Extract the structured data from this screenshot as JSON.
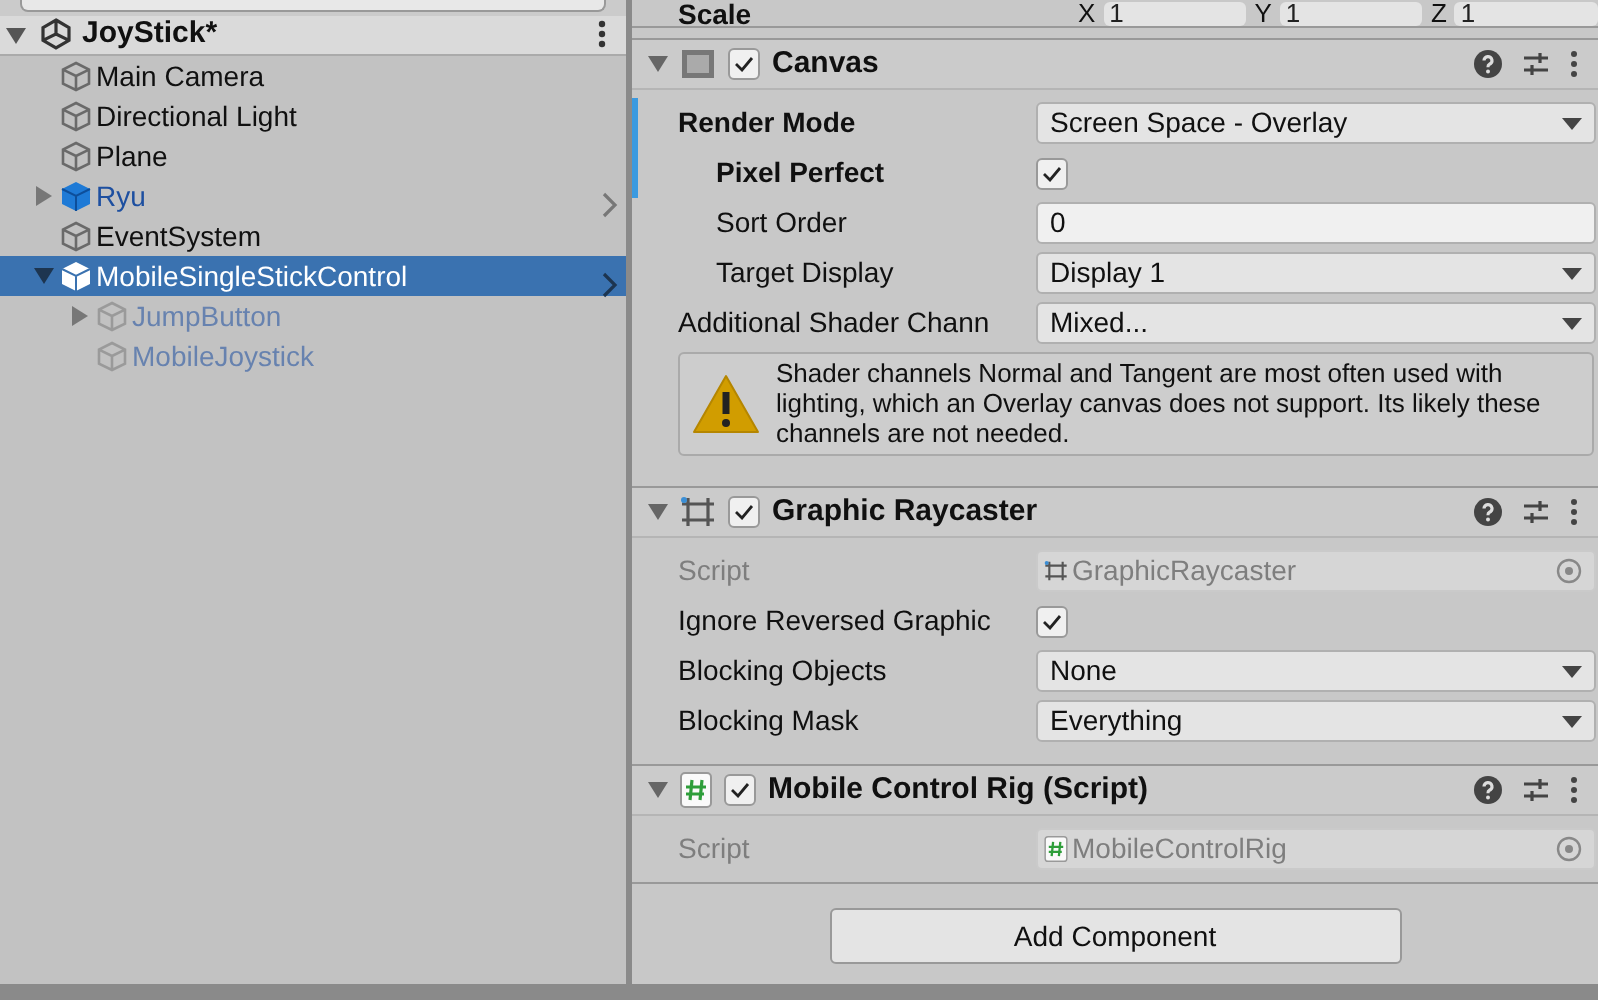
{
  "hierarchy": {
    "scene": {
      "name": "JoyStick*",
      "expanded": true
    },
    "items": [
      {
        "name": "Main Camera",
        "prefab": false,
        "active": true,
        "selected": false,
        "expandable": false
      },
      {
        "name": "Directional Light",
        "prefab": false,
        "active": true,
        "selected": false,
        "expandable": false
      },
      {
        "name": "Plane",
        "prefab": false,
        "active": true,
        "selected": false,
        "expandable": false
      },
      {
        "name": "Ryu",
        "prefab": true,
        "active": true,
        "selected": false,
        "expandable": true,
        "expanded": false
      },
      {
        "name": "EventSystem",
        "prefab": false,
        "active": true,
        "selected": false,
        "expandable": false
      },
      {
        "name": "MobileSingleStickControl",
        "prefab": true,
        "active": true,
        "selected": true,
        "expandable": true,
        "expanded": true,
        "children": [
          {
            "name": "JumpButton",
            "prefab": true,
            "active": false,
            "selected": false,
            "expandable": true,
            "expanded": false
          },
          {
            "name": "MobileJoystick",
            "prefab": true,
            "active": false,
            "selected": false,
            "expandable": false
          }
        ]
      }
    ]
  },
  "inspector": {
    "partial_row": {
      "label": "Scale",
      "fields": [
        {
          "axis": "X",
          "value": "1"
        },
        {
          "axis": "Y",
          "value": "1"
        },
        {
          "axis": "Z",
          "value": "1"
        }
      ]
    },
    "components": [
      {
        "title": "Canvas",
        "kind": "canvas",
        "enabled": true,
        "expanded": true,
        "rows": [
          {
            "kind": "dropdown",
            "label": "Render Mode",
            "value": "Screen Space - Overlay",
            "modified": true,
            "disabled": false,
            "children": [
              {
                "kind": "checkbox",
                "label": "Pixel Perfect",
                "checked": true,
                "modified": true,
                "disabled": false
              },
              {
                "kind": "text",
                "label": "Sort Order",
                "value": "0",
                "modified": false,
                "disabled": false
              },
              {
                "kind": "dropdown",
                "label": "Target Display",
                "value": "Display 1",
                "modified": false,
                "disabled": false
              }
            ]
          },
          {
            "kind": "dropdown",
            "label": "Additional Shader Chann",
            "value": "Mixed...",
            "modified": false,
            "disabled": false
          },
          {
            "kind": "warning",
            "text": "Shader channels Normal and Tangent are most often used with lighting, which an Overlay canvas does not support. Its likely these channels are not needed."
          }
        ]
      },
      {
        "title": "Graphic Raycaster",
        "kind": "raycaster",
        "enabled": true,
        "expanded": true,
        "rows": [
          {
            "kind": "object",
            "label": "Script",
            "value": "GraphicRaycaster",
            "modified": false,
            "disabled": true
          },
          {
            "kind": "checkbox",
            "label": "Ignore Reversed Graphic",
            "checked": true,
            "modified": false,
            "disabled": false
          },
          {
            "kind": "dropdown",
            "label": "Blocking Objects",
            "value": "None",
            "modified": false,
            "disabled": false
          },
          {
            "kind": "dropdown",
            "label": "Blocking Mask",
            "value": "Everything",
            "modified": false,
            "disabled": false
          }
        ]
      },
      {
        "title": "Mobile Control Rig (Script)",
        "kind": "script",
        "enabled": true,
        "expanded": true,
        "rows": [
          {
            "kind": "object",
            "label": "Script",
            "value": "MobileControlRig",
            "modified": false,
            "disabled": true
          }
        ]
      }
    ],
    "add_button": "Add Component"
  }
}
